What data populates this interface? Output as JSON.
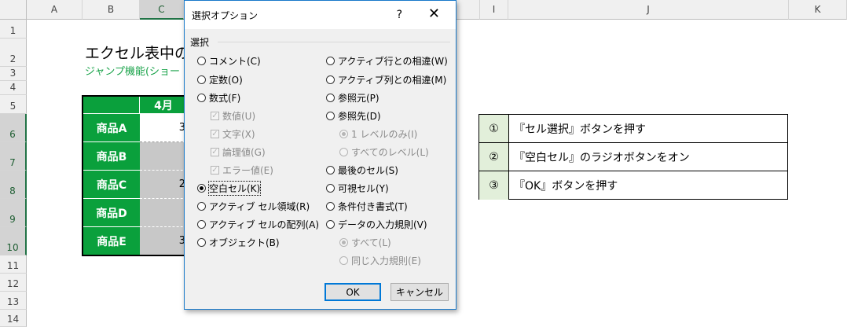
{
  "columns": [
    "A",
    "B",
    "C",
    "I",
    "J",
    "K"
  ],
  "rows": [
    "1",
    "2",
    "3",
    "4",
    "5",
    "6",
    "7",
    "8",
    "9",
    "10",
    "11",
    "12",
    "13",
    "14"
  ],
  "sheet": {
    "title": "エクセル表中の",
    "subtitle": "ジャンプ機能(ショー",
    "table_header": "4月",
    "products": [
      {
        "name": "商品A",
        "value": "3"
      },
      {
        "name": "商品B",
        "value": ""
      },
      {
        "name": "商品C",
        "value": "2"
      },
      {
        "name": "商品D",
        "value": ""
      },
      {
        "name": "商品E",
        "value": "3"
      }
    ]
  },
  "instructions": [
    {
      "num": "①",
      "text": "『セル選択』ボタンを押す"
    },
    {
      "num": "②",
      "text": "『空白セル』のラジオボタンをオン"
    },
    {
      "num": "③",
      "text": "『OK』ボタンを押す"
    }
  ],
  "dialog": {
    "title": "選択オプション",
    "help": "?",
    "close": "✕",
    "group_label": "選択",
    "left_options": [
      "コメント(C)",
      "定数(O)",
      "数式(F)",
      "数値(U)",
      "文字(X)",
      "論理値(G)",
      "エラー値(E)",
      "空白セル(K)",
      "アクティブ セル領域(R)",
      "アクティブ セルの配列(A)",
      "オブジェクト(B)"
    ],
    "right_options": [
      "アクティブ行との相違(W)",
      "アクティブ列との相違(M)",
      "参照元(P)",
      "参照先(D)",
      "1 レベルのみ(I)",
      "すべてのレベル(L)",
      "最後のセル(S)",
      "可視セル(Y)",
      "条件付き書式(T)",
      "データの入力規則(V)",
      "すべて(L)",
      "同じ入力規則(E)"
    ],
    "ok": "OK",
    "cancel": "キャンセル"
  }
}
